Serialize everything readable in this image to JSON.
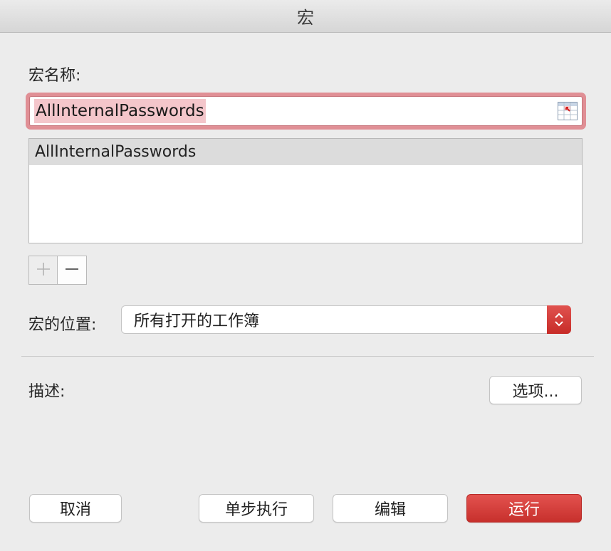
{
  "window": {
    "title": "宏"
  },
  "macro_name": {
    "label": "宏名称:",
    "value": "AllInternalPasswords",
    "ref_icon": "range-select-icon"
  },
  "macro_list": {
    "items": [
      "AllInternalPasswords"
    ],
    "selected_index": 0
  },
  "list_controls": {
    "add_icon": "plus-icon",
    "remove_icon": "minus-icon"
  },
  "location": {
    "label": "宏的位置:",
    "selected": "所有打开的工作簿",
    "stepper_icon": "updown-chevron-icon"
  },
  "description": {
    "label": "描述:"
  },
  "buttons": {
    "options": "选项...",
    "cancel": "取消",
    "step": "单步执行",
    "edit": "编辑",
    "run": "运行"
  },
  "colors": {
    "accent": "#d63a36",
    "focus_ring": "#e08f95",
    "selection_highlight": "#f4c6cb"
  }
}
